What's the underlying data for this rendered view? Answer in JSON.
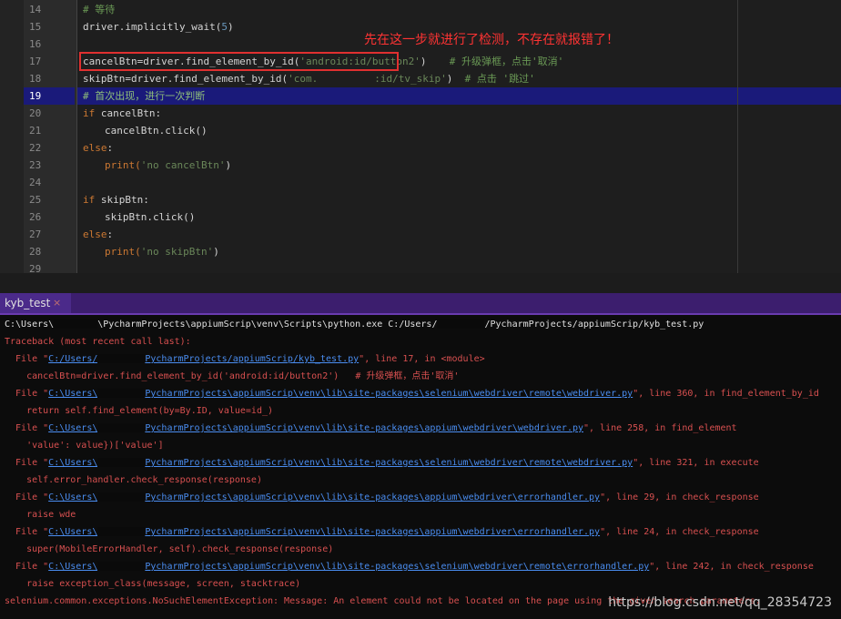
{
  "editor": {
    "line_numbers": [
      "14",
      "15",
      "16",
      "17",
      "18",
      "19",
      "20",
      "21",
      "22",
      "23",
      "24",
      "25",
      "26",
      "27",
      "28",
      "29"
    ],
    "active_line": "19",
    "annotation": "先在这一步就进行了检测，不存在就报错了！",
    "lines": {
      "l14": "# 等待",
      "l15_a": "driver.implicitly_wait(",
      "l15_num": "5",
      "l15_b": ")",
      "l17_a": "cancelBtn=driver.find_element_by_id(",
      "l17_str": "'android:id/button2'",
      "l17_b": ")",
      "l17_cmt": "  # 升级弹框，点击'取消'",
      "l18_a": "skipBtn=driver.find_element_by_id(",
      "l18_str_a": "'com.",
      "l18_str_b": ":id/tv_skip'",
      "l18_b": ")",
      "l18_cmt": "  # 点击 '跳过'",
      "l19": "# 首次出现，进行一次判断",
      "l20_kw": "if",
      "l20_b": " cancelBtn:",
      "l21": "cancelBtn.click()",
      "l22_kw": "else",
      "l22_b": ":",
      "l23_fn": "print(",
      "l23_str": "'no cancelBtn'",
      "l23_b": ")",
      "l25_kw": "if",
      "l25_b": " skipBtn:",
      "l26": "skipBtn.click()",
      "l27_kw": "else",
      "l27_b": ":",
      "l28_fn": "print(",
      "l28_str": "'no skipBtn'",
      "l28_b": ")"
    }
  },
  "terminal": {
    "tab_label": "kyb_test",
    "tab_close": "×",
    "cmd_a": "C:\\Users\\",
    "cmd_b": "\\PycharmProjects\\appiumScrip\\venv\\Scripts\\python.exe C:/Users/",
    "cmd_c": "/PycharmProjects/appiumScrip/kyb_test.py",
    "traceback": "Traceback (most recent call last):",
    "f1_pre": "  File \"",
    "f1_link_a": "C:/Users/",
    "f1_link_b": "PycharmProjects/appiumScrip/kyb_test.py",
    "f1_post": "\", line 17, in <module>",
    "f1_code": "    cancelBtn=driver.find_element_by_id('android:id/button2')   # 升级弹框，点击'取消'",
    "f2_link_b": "PycharmProjects\\appiumScrip\\venv\\lib\\site-packages\\selenium\\webdriver\\remote\\webdriver.py",
    "f2_post": "\", line 360, in find_element_by_id",
    "f2_code": "    return self.find_element(by=By.ID, value=id_)",
    "f3_link_b": "PycharmProjects\\appiumScrip\\venv\\lib\\site-packages\\appium\\webdriver\\webdriver.py",
    "f3_post": "\", line 258, in find_element",
    "f3_code": "    'value': value})['value']",
    "f4_link_b": "PycharmProjects\\appiumScrip\\venv\\lib\\site-packages\\selenium\\webdriver\\remote\\webdriver.py",
    "f4_post": "\", line 321, in execute",
    "f4_code": "    self.error_handler.check_response(response)",
    "f5_link_b": "PycharmProjects\\appiumScrip\\venv\\lib\\site-packages\\appium\\webdriver\\errorhandler.py",
    "f5_post": "\", line 29, in check_response",
    "f5_code": "    raise wde",
    "f6_link_b": "PycharmProjects\\appiumScrip\\venv\\lib\\site-packages\\appium\\webdriver\\errorhandler.py",
    "f6_post": "\", line 24, in check_response",
    "f6_code": "    super(MobileErrorHandler, self).check_response(response)",
    "f7_link_b": "PycharmProjects\\appiumScrip\\venv\\lib\\site-packages\\selenium\\webdriver\\remote\\errorhandler.py",
    "f7_post": "\", line 242, in check_response",
    "f7_code": "    raise exception_class(message, screen, stacktrace)",
    "link_prefix": "C:\\Users\\",
    "exception": "selenium.common.exceptions.NoSuchElementException: Message: An element could not be located on the page using the given search parameters."
  },
  "watermark": "https://blog.csdn.net/qq_28354723"
}
